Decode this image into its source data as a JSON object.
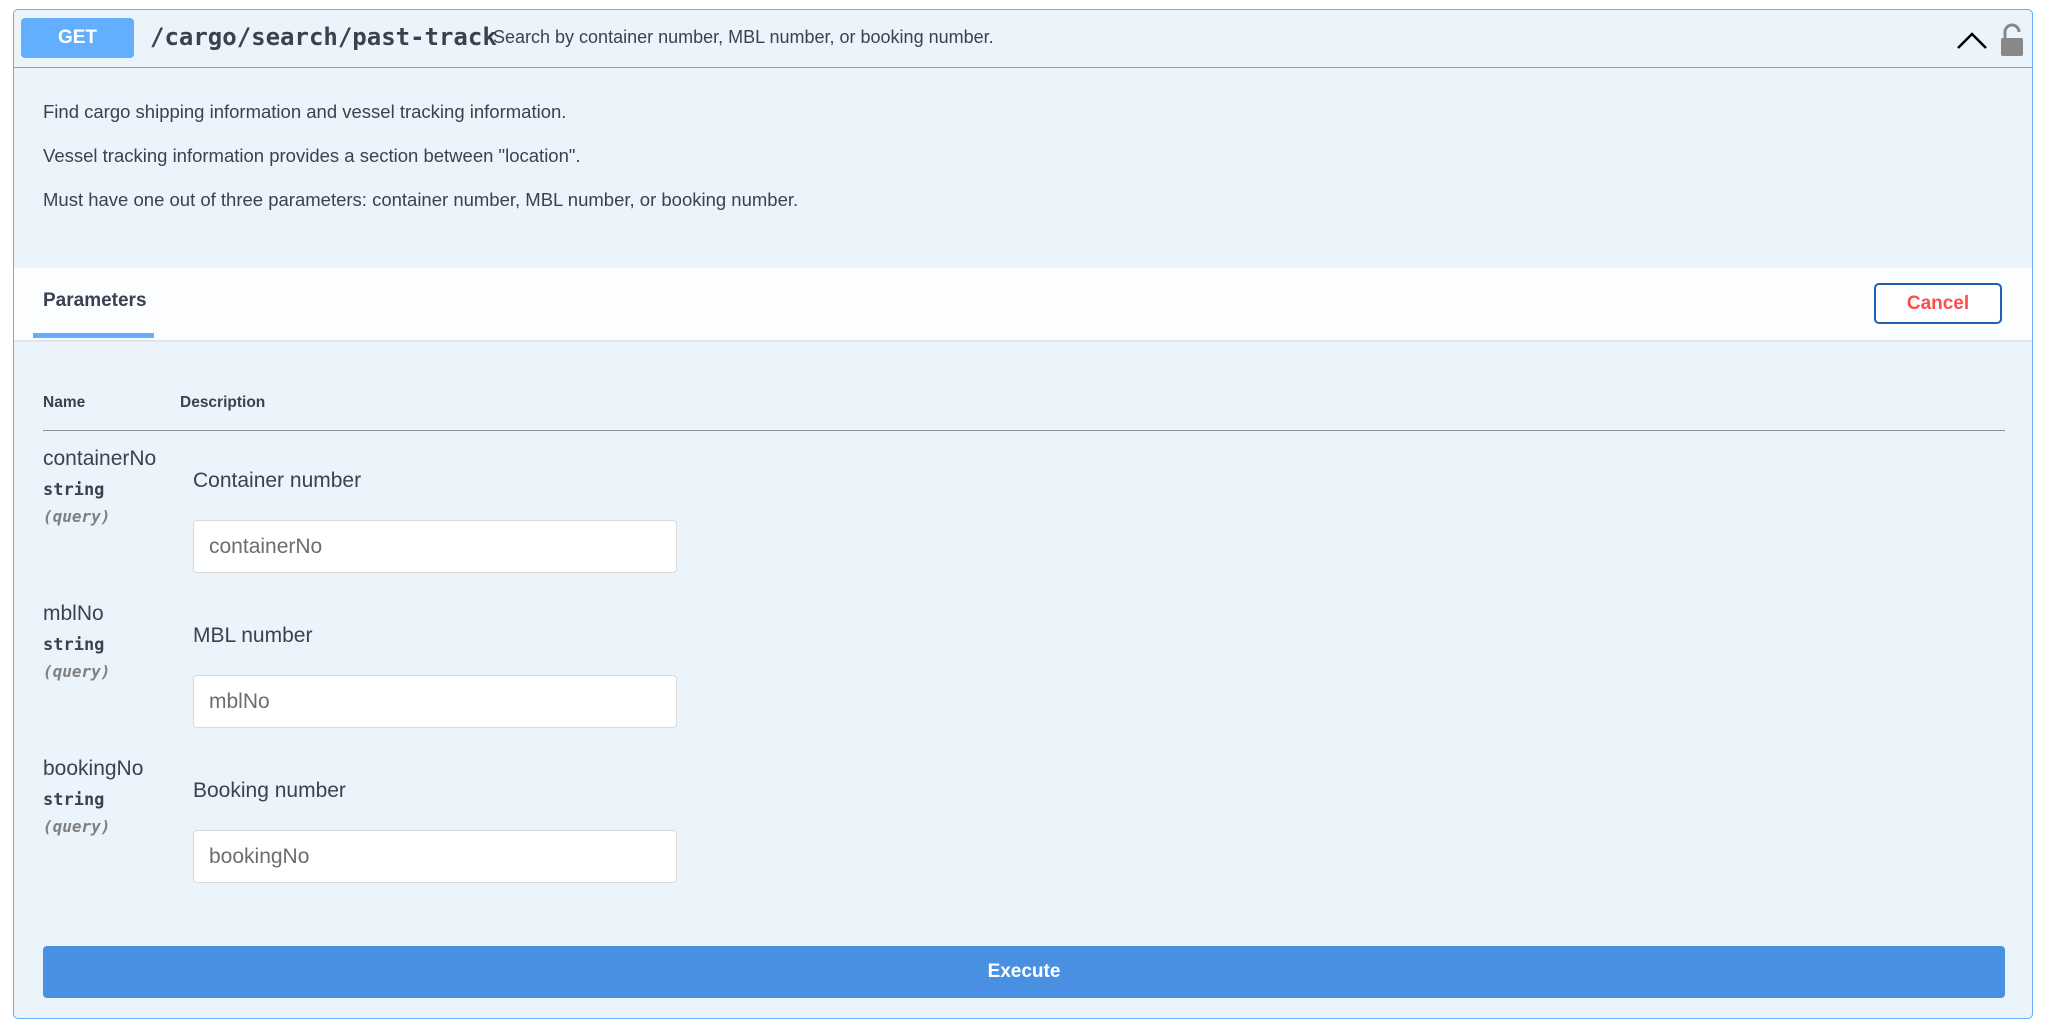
{
  "operation": {
    "method": "GET",
    "path": "/cargo/search/past-track",
    "summary": "Search by container number, MBL number, or booking number.",
    "expanded": true,
    "locked": false
  },
  "description": [
    "Find cargo shipping information and vessel tracking information.",
    "Vessel tracking information provides a section between \"location\".",
    "Must have one out of three parameters: container number, MBL number, or booking number."
  ],
  "parameters_section": {
    "tab_label": "Parameters",
    "cancel_label": "Cancel",
    "column_name": "Name",
    "column_description": "Description",
    "params": [
      {
        "name": "containerNo",
        "type": "string",
        "in": "(query)",
        "description": "Container number",
        "placeholder": "containerNo",
        "value": ""
      },
      {
        "name": "mblNo",
        "type": "string",
        "in": "(query)",
        "description": "MBL number",
        "placeholder": "mblNo",
        "value": ""
      },
      {
        "name": "bookingNo",
        "type": "string",
        "in": "(query)",
        "description": "Booking number",
        "placeholder": "bookingNo",
        "value": ""
      }
    ]
  },
  "execute_label": "Execute",
  "icons": {
    "collapse": "chevron-up-icon",
    "auth": "lock-icon"
  },
  "colors": {
    "method_get": "#61affe",
    "execute": "#4990e2",
    "cancel_text": "#ff4d4d",
    "cancel_border": "#1e5fb3",
    "block_background": "#ebf3fb"
  }
}
